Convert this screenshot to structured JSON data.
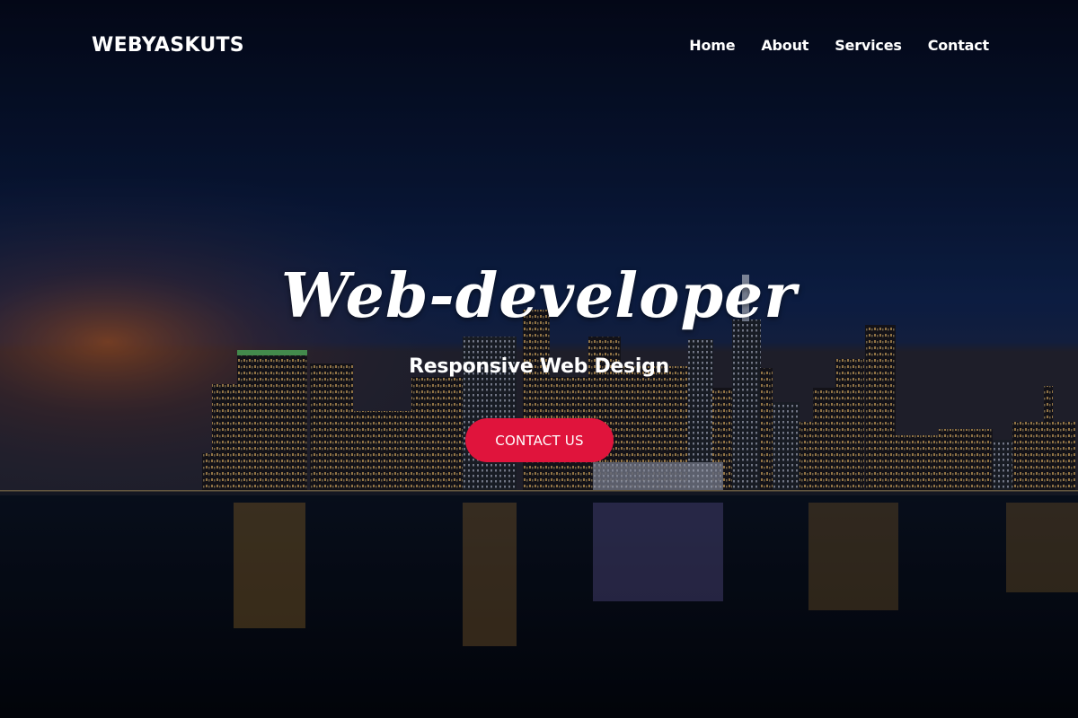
{
  "brand": {
    "logo_text": "WEBYASKUTS"
  },
  "nav": {
    "items": [
      {
        "label": "Home"
      },
      {
        "label": "About"
      },
      {
        "label": "Services"
      },
      {
        "label": "Contact"
      }
    ]
  },
  "hero": {
    "title": "Web-developer",
    "subtitle": "Responsive Web Design",
    "cta_label": "CONTACT US",
    "background": "night-city-skyline-image"
  },
  "colors": {
    "sky_top": "#060d25",
    "sky_mid": "#0d2656",
    "horizon_glow": "#b0562a",
    "water": "#060b17",
    "cta": "#e0143c",
    "text": "#ffffff"
  }
}
